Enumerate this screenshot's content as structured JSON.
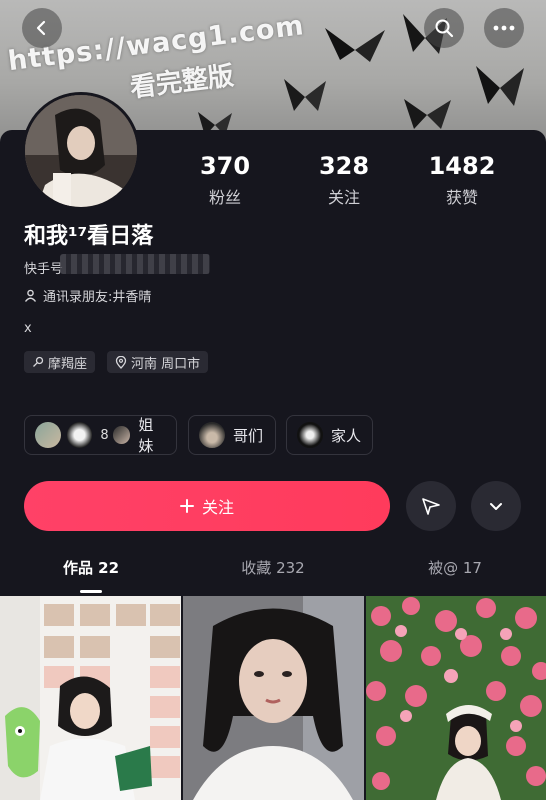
{
  "watermark": {
    "url": "https://wacg1.com",
    "subtitle": "看完整版"
  },
  "profile": {
    "nickname": "和我¹⁷看日落",
    "kuaishou_prefix": "快手号",
    "contact_friend": "通讯录朋友:井香晴",
    "bio": "x",
    "tags": [
      {
        "icon": "zodiac-icon",
        "label": "摩羯座"
      },
      {
        "icon": "location-pin-icon",
        "label": "河南 周口市"
      }
    ]
  },
  "stats": [
    {
      "value": "370",
      "label": "粉丝"
    },
    {
      "value": "328",
      "label": "关注"
    },
    {
      "value": "1482",
      "label": "获赞"
    }
  ],
  "groups": [
    {
      "label": "姐妹",
      "count": "8"
    },
    {
      "label": "哥们"
    },
    {
      "label": "家人"
    }
  ],
  "actions": {
    "follow_label": "关注"
  },
  "tabs": [
    {
      "label": "作品 22"
    },
    {
      "label": "收藏 232"
    },
    {
      "label": "被@ 17"
    }
  ],
  "colors": {
    "accent": "#ff3b5c",
    "background": "#16161e"
  }
}
